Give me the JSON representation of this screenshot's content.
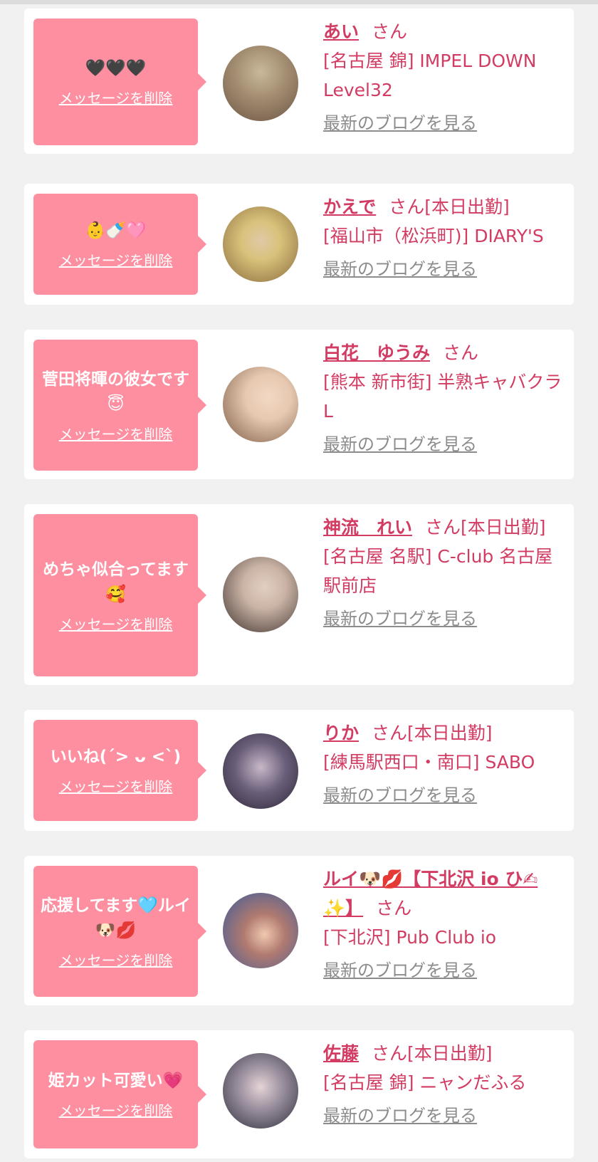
{
  "common": {
    "delete_label": "メッセージを削除",
    "blog_label": "最新のブログを見る"
  },
  "items": [
    {
      "message": "🖤🖤🖤",
      "name": "あい",
      "suffix": "さん",
      "shop": "[名古屋 錦] IMPEL DOWN Level32",
      "avatar_colors": [
        "#c9b99a",
        "#6e5644"
      ]
    },
    {
      "message": "👶🍼🩷",
      "name": "かえで",
      "suffix": "さん[本日出勤]",
      "shop": "[福山市（松浜町)] DIARY'S",
      "avatar_colors": [
        "#d8c27a",
        "#8a6a3e"
      ]
    },
    {
      "message": "菅田将暉の彼女です😇",
      "name": "白花　ゆうみ",
      "suffix": "さん",
      "shop": "[熊本 新市街] 半熟キャバクラ L",
      "avatar_colors": [
        "#e7c8b0",
        "#7b5b45"
      ]
    },
    {
      "message": "めちゃ似合ってます🥰",
      "name": "神流　れい",
      "suffix": "さん[本日出勤]",
      "shop": "[名古屋 名駅] C-club 名古屋駅前店",
      "avatar_colors": [
        "#cbb4a6",
        "#3c302c"
      ]
    },
    {
      "message": "いいね(ˊ> ᴗ <ˋ)",
      "name": "りか",
      "suffix": "さん[本日出勤]",
      "shop": "[練馬駅西口・南口] SABO",
      "avatar_colors": [
        "#6a5f7a",
        "#2d2535"
      ]
    },
    {
      "message": "応援してます🩵ルイ🐶💋",
      "name": "ルイ🐶💋【下北沢 io ひ✍︎✨】",
      "suffix": "さん",
      "shop": "[下北沢] Pub Club io",
      "avatar_colors": [
        "#3a5a9a",
        "#f0c9b0"
      ]
    },
    {
      "message": "姫カット可愛い💗",
      "name": "佐藤",
      "suffix": "さん[本日出勤]",
      "shop": "[名古屋 錦] ニャンだふる",
      "avatar_colors": [
        "#6c6c80",
        "#e5d4d6"
      ]
    }
  ]
}
